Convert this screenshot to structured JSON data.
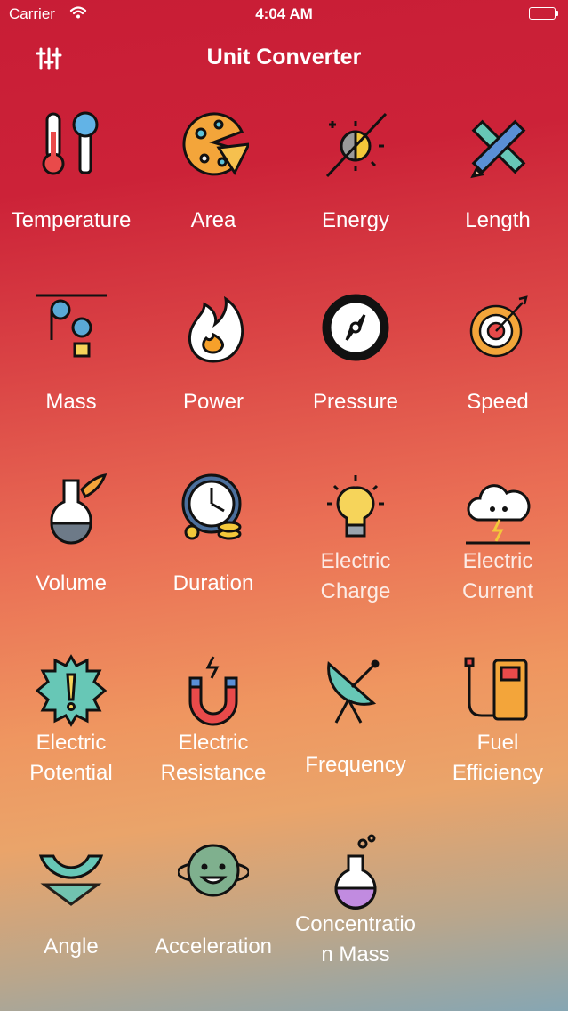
{
  "status_bar": {
    "carrier": "Carrier",
    "time": "4:04 AM"
  },
  "nav": {
    "title": "Unit Converter",
    "settings_icon": "sliders-icon"
  },
  "categories": [
    {
      "label": "Temperature",
      "icon": "thermometer-icon"
    },
    {
      "label": "Area",
      "icon": "pizza-icon"
    },
    {
      "label": "Energy",
      "icon": "sun-moon-icon"
    },
    {
      "label": "Length",
      "icon": "ruler-pencil-icon"
    },
    {
      "label": "Mass",
      "icon": "pulley-icon"
    },
    {
      "label": "Power",
      "icon": "flame-icon"
    },
    {
      "label": "Pressure",
      "icon": "compass-gauge-icon"
    },
    {
      "label": "Speed",
      "icon": "target-arrow-icon"
    },
    {
      "label": "Volume",
      "icon": "flask-leaf-icon"
    },
    {
      "label": "Duration",
      "icon": "clock-coins-icon"
    },
    {
      "label": "Electric\nCharge",
      "icon": "light-bulb-icon"
    },
    {
      "label": "Electric\nCurrent",
      "icon": "storm-cloud-icon"
    },
    {
      "label": "Electric\nPotential",
      "icon": "warning-burst-icon"
    },
    {
      "label": "Electric\nResistance",
      "icon": "magnet-icon"
    },
    {
      "label": "Frequency",
      "icon": "satellite-dish-icon"
    },
    {
      "label": "Fuel\nEfficiency",
      "icon": "fuel-pump-icon"
    },
    {
      "label": "Angle",
      "icon": "protractor-icon"
    },
    {
      "label": "Acceleration",
      "icon": "planet-icon"
    },
    {
      "label": "Concentratio\nn Mass",
      "icon": "beaker-bubbles-icon"
    }
  ]
}
